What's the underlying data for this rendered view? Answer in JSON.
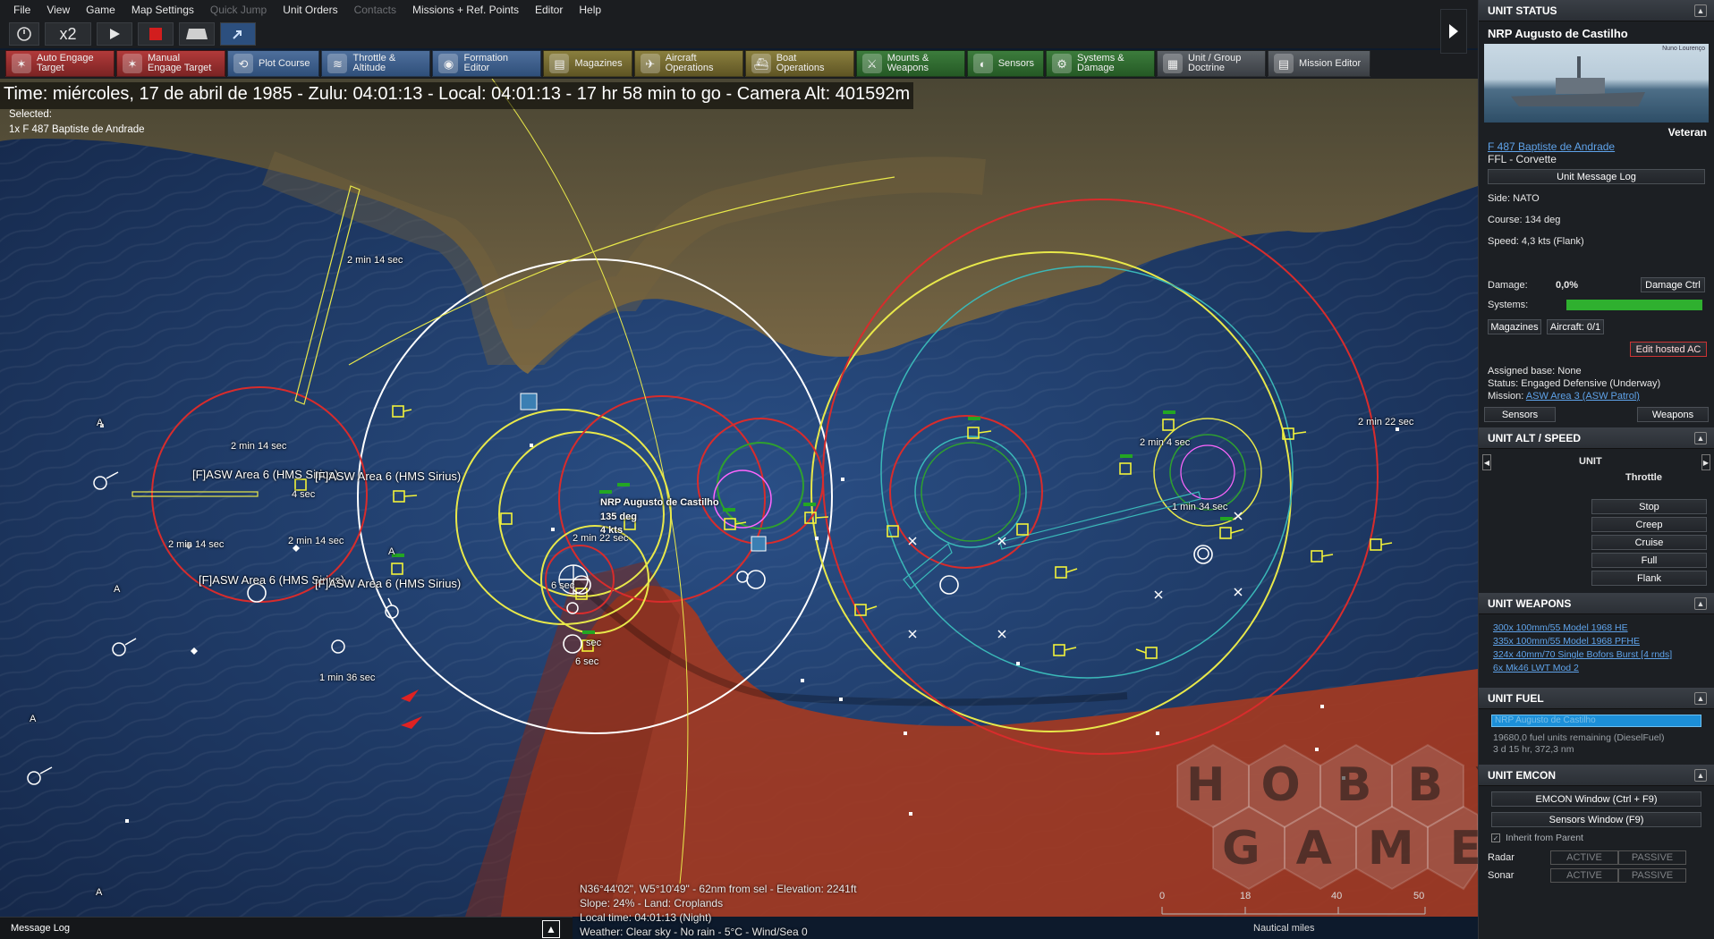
{
  "menu": [
    "File",
    "View",
    "Game",
    "Map Settings",
    "Quick Jump",
    "Unit Orders",
    "Contacts",
    "Missions + Ref. Points",
    "Editor",
    "Help"
  ],
  "controls": {
    "speed": "x2"
  },
  "toolbar": [
    {
      "label": "Auto Engage Target",
      "color": "red"
    },
    {
      "label": "Manual Engage Target",
      "color": "red"
    },
    {
      "label": "Plot Course",
      "color": "blue"
    },
    {
      "label": "Throttle & Altitude",
      "color": "blue"
    },
    {
      "label": "Formation Editor",
      "color": "blue"
    },
    {
      "label": "Magazines",
      "color": "olive"
    },
    {
      "label": "Aircraft Operations",
      "color": "olive"
    },
    {
      "label": "Boat Operations",
      "color": "olive"
    },
    {
      "label": "Mounts & Weapons",
      "color": "green"
    },
    {
      "label": "Sensors",
      "color": "green"
    },
    {
      "label": "Systems & Damage",
      "color": "green"
    },
    {
      "label": "Unit / Group Doctrine",
      "color": "gray"
    },
    {
      "label": "Mission Editor",
      "color": "gray"
    }
  ],
  "time_banner": "Time: miércoles, 17 de abril de 1985 - Zulu: 04:01:13 - Local: 04:01:13 - 17 hr 58 min to go -  Camera Alt: 401592m",
  "selected": {
    "label": "Selected:",
    "unit": "1x F 487 Baptiste de Andrade"
  },
  "map_labels": {
    "t1": "2 min 14 sec",
    "t2": "2 min 14 sec",
    "t3": "2 min 14 sec",
    "t4": "2 min 14 sec",
    "t5": "4 sec",
    "asw1": "[F]ASW Area 6 (HMS Sirius)",
    "asw2": "[F]ASW Area 6 (HMS Sirius)",
    "asw3": "[F]ASW Area 6 (HMS Sirius)",
    "asw4": "[F]ASW Area 6 (HMS Sirius)",
    "sel_name": "NRP Augusto de Castilho",
    "sel_course": "135 deg",
    "sel_speed": "4 kts",
    "t6": "2 min 22 sec",
    "t7": "6 sec",
    "t8": "6 sec",
    "t9": "sec",
    "t10": "1 min 36 sec",
    "t11": "2 min 4 sec",
    "t12": "1 min 34 sec",
    "t13": "2 min 22 sec",
    "a": "A"
  },
  "cursor_info": {
    "line1": "N36°44'02\", W5°10'49\" - 62nm from sel - Elevation: 2241ft",
    "line2": "Slope: 24%  - Land: Croplands",
    "line3": "Local time: 04:01:13 (Night)",
    "line4": "Weather: Clear sky - No rain - 5°C - Wind/Sea 0"
  },
  "scale": {
    "ticks": [
      "0",
      "18",
      "40",
      "50"
    ],
    "unit": "Nautical miles"
  },
  "message_log": "Message Log",
  "watermark": [
    "HOBBY",
    "GAMES"
  ],
  "panel": {
    "status_title": "UNIT STATUS",
    "unit_name": "NRP Augusto de Castilho",
    "photo_credit": "Nuno Lourenço",
    "rank": "Veteran",
    "class_link": "F 487 Baptiste de Andrade",
    "class_type": "FFL - Corvette",
    "msg_log_btn": "Unit Message Log",
    "side": "Side: NATO",
    "course": "Course: 134 deg",
    "speed": "Speed: 4,3 kts (Flank)",
    "damage_lbl": "Damage:",
    "damage_val": "0,0%",
    "damage_btn": "Damage Ctrl",
    "systems_lbl": "Systems:",
    "magazines_btn": "Magazines",
    "aircraft_btn": "Aircraft: 0/1",
    "edit_hosted_btn": "Edit hosted AC",
    "assigned_base": "Assigned base: None",
    "status": "Status: Engaged Defensive (Underway)",
    "mission_lbl": "Mission:",
    "mission_link": "ASW Area 3 (ASW Patrol)",
    "sensors_btn": "Sensors",
    "weapons_btn": "Weapons",
    "alt_title": "UNIT ALT / SPEED",
    "alt_unit": "UNIT",
    "alt_throttle": "Throttle",
    "throttle_opts": [
      "Stop",
      "Creep",
      "Cruise",
      "Full",
      "Flank"
    ],
    "weapons_title": "UNIT WEAPONS",
    "weapons": [
      "300x 100mm/55 Model 1968 HE",
      "335x 100mm/55 Model 1968 PFHE",
      "324x 40mm/70 Single Bofors Burst [4 rnds]",
      "6x Mk46 LWT Mod 2"
    ],
    "fuel_title": "UNIT FUEL",
    "fuel_bar": "NRP Augusto de Castilho",
    "fuel_line1": "19680,0 fuel units remaining (DieselFuel)",
    "fuel_line2": "3 d 15 hr, 372,3 nm",
    "emcon_title": "UNIT EMCON",
    "emcon_btn": "EMCON Window (Ctrl + F9)",
    "sensors_window_btn": "Sensors Window (F9)",
    "inherit": "Inherit from Parent",
    "radar_lbl": "Radar",
    "sonar_lbl": "Sonar",
    "active": "ACTIVE",
    "passive": "PASSIVE"
  },
  "colors": {
    "sea": "#1f3f72",
    "land": "#6a5a3c",
    "hostile_zone": "#b4351f",
    "systems_green": "#2fb02f",
    "link": "#5fa3ea"
  }
}
